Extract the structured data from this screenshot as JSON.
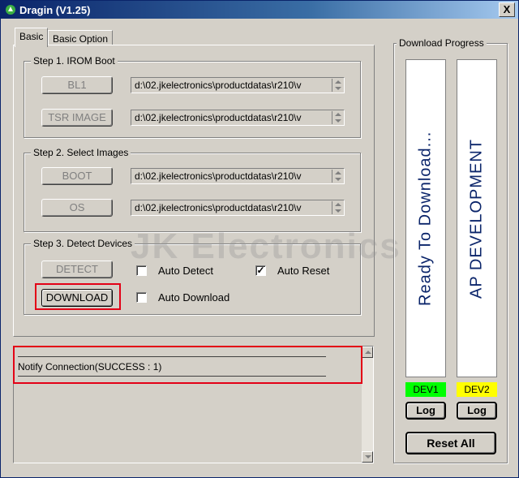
{
  "window": {
    "title": "Dragin (V1.25)",
    "close_label": "X"
  },
  "tabs": [
    {
      "label": "Basic"
    },
    {
      "label": "Basic Option"
    }
  ],
  "step1": {
    "title": "Step 1. IROM Boot",
    "bl1_label": "BL1",
    "bl1_path": "d:\\02.jkelectronics\\productdatas\\r210\\v",
    "tsr_label": "TSR IMAGE",
    "tsr_path": "d:\\02.jkelectronics\\productdatas\\r210\\v"
  },
  "step2": {
    "title": "Step 2. Select Images",
    "boot_label": "BOOT",
    "boot_path": "d:\\02.jkelectronics\\productdatas\\r210\\v",
    "os_label": "OS",
    "os_path": "d:\\02.jkelectronics\\productdatas\\r210\\v"
  },
  "step3": {
    "title": "Step 3. Detect Devices",
    "detect_label": "DETECT",
    "download_label": "DOWNLOAD",
    "auto_detect_label": "Auto Detect",
    "auto_detect_checked": false,
    "auto_reset_label": "Auto Reset",
    "auto_reset_checked": true,
    "auto_download_label": "Auto Download",
    "auto_download_checked": false
  },
  "log": {
    "separator": "--------------------------------------------------------------------------------------------------------------------------",
    "message": "Notify Connection(SUCCESS : 1)"
  },
  "progress": {
    "title": "Download Progress",
    "dev1": {
      "text": "Ready To Download...",
      "label": "DEV1",
      "color": "#00ff00",
      "log_label": "Log"
    },
    "dev2": {
      "text": "AP DEVELOPMENT",
      "label": "DEV2",
      "color": "#ffff00",
      "log_label": "Log"
    },
    "reset_all_label": "Reset All"
  },
  "watermark": "JK Electronics",
  "colors": {
    "highlight": "#e30016",
    "vertical_text": "#0a246a"
  },
  "icons": {
    "title": "dragin-app-icon",
    "close": "close-icon"
  }
}
